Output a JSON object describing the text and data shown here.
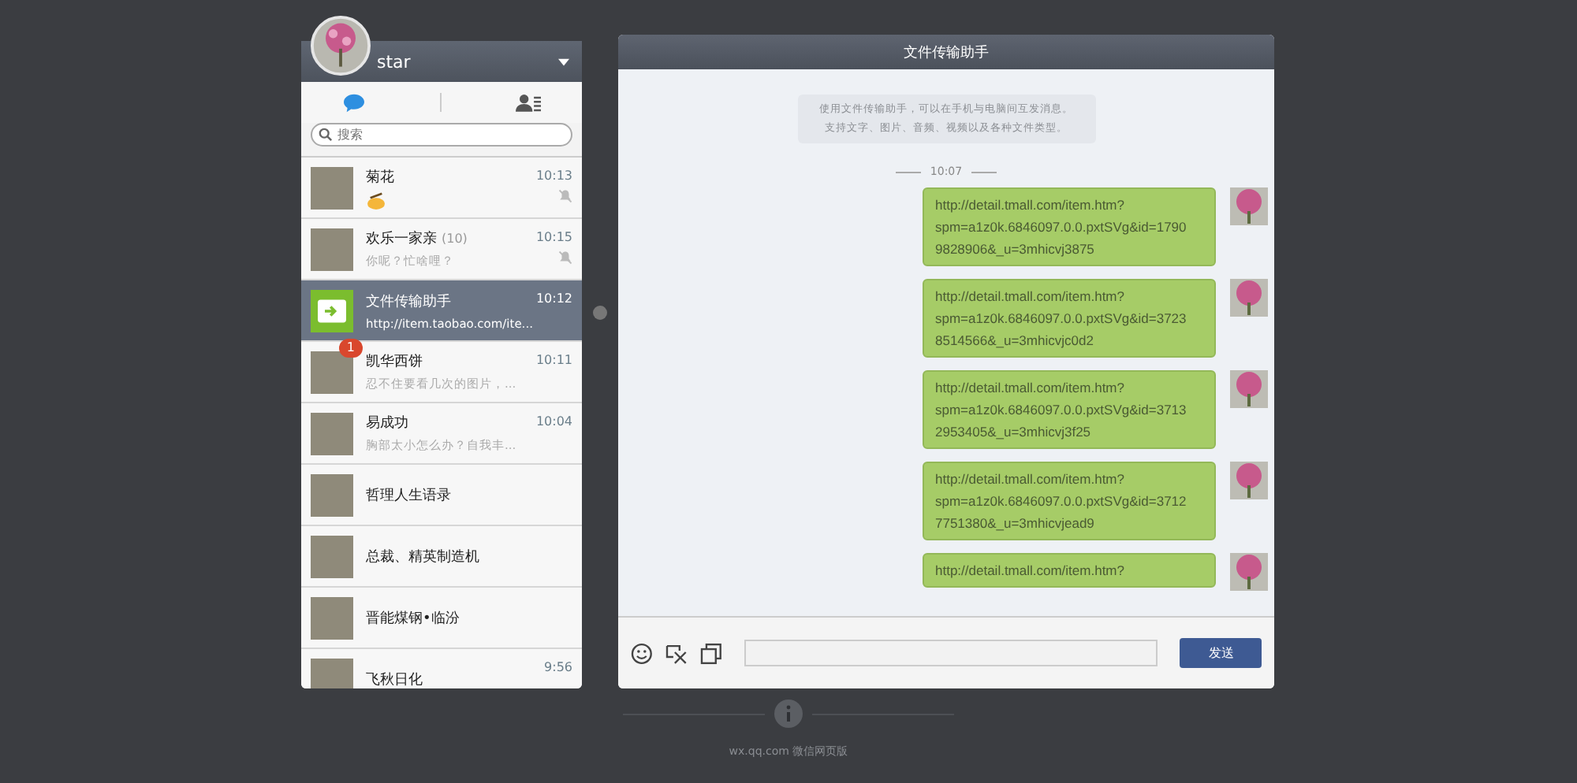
{
  "user": {
    "name": "star"
  },
  "tabs": [
    {
      "kind": "chats",
      "selected": true
    },
    {
      "kind": "contacts",
      "selected": false
    }
  ],
  "search": {
    "placeholder": "搜索"
  },
  "conversations": [
    {
      "name": "菊花",
      "kind": "photo",
      "sticker": true,
      "time": "10:13",
      "muted": true,
      "selected": false
    },
    {
      "name": "欢乐一家亲",
      "count": "(10)",
      "kind": "photo",
      "sticker": false,
      "preview": "你呢？忙啥哩？",
      "time": "10:15",
      "muted": true,
      "selected": false
    },
    {
      "name": "文件传输助手",
      "kind": "file",
      "sticker": false,
      "preview": "http://item.taobao.com/ite...",
      "time": "10:12",
      "muted": false,
      "selected": true
    },
    {
      "name": "凯华西饼",
      "kind": "photo",
      "sticker": false,
      "badge": "1",
      "preview": "忍不住要看几次的图片，...",
      "time": "10:11",
      "muted": false,
      "selected": false
    },
    {
      "name": "易成功",
      "kind": "photo",
      "sticker": false,
      "preview": "胸部太小怎么办？自我丰...",
      "time": "10:04",
      "muted": false,
      "selected": false
    },
    {
      "name": "哲理人生语录",
      "kind": "photo",
      "sticker": false,
      "muted": false,
      "selected": false
    },
    {
      "name": "总裁、精英制造机",
      "kind": "photo",
      "sticker": false,
      "muted": false,
      "selected": false
    },
    {
      "name": "晋能煤钢•临汾",
      "kind": "photo",
      "sticker": false,
      "muted": false,
      "selected": false
    },
    {
      "name": "飞秋日化",
      "kind": "photo",
      "sticker": false,
      "time": "9:56",
      "muted": false,
      "selected": false
    }
  ],
  "chat": {
    "title": "文件传输助手",
    "notice": [
      "使用文件传输助手，可以在手机与电脑间互发消息。",
      "支持文字、图片、音频、视频以及各种文件类型。"
    ],
    "time_divider": "10:07",
    "messages": [
      {
        "lines": [
          "http://detail.tmall.com/item.htm?",
          "spm=a1z0k.6846097.0.0.pxtSVg&id=1790",
          "9828906&_u=3mhicvj3875"
        ]
      },
      {
        "lines": [
          "http://detail.tmall.com/item.htm?",
          "spm=a1z0k.6846097.0.0.pxtSVg&id=3723",
          "8514566&_u=3mhicvjc0d2"
        ]
      },
      {
        "lines": [
          "http://detail.tmall.com/item.htm?",
          "spm=a1z0k.6846097.0.0.pxtSVg&id=3713",
          "2953405&_u=3mhicvj3f25"
        ]
      },
      {
        "lines": [
          "http://detail.tmall.com/item.htm?",
          "spm=a1z0k.6846097.0.0.pxtSVg&id=3712",
          "7751380&_u=3mhicvjead9"
        ]
      },
      {
        "lines": [
          "http://detail.tmall.com/item.htm?"
        ]
      }
    ],
    "send_button": "发送"
  },
  "footer": {
    "text": "wx.qq.com 微信网页版"
  }
}
